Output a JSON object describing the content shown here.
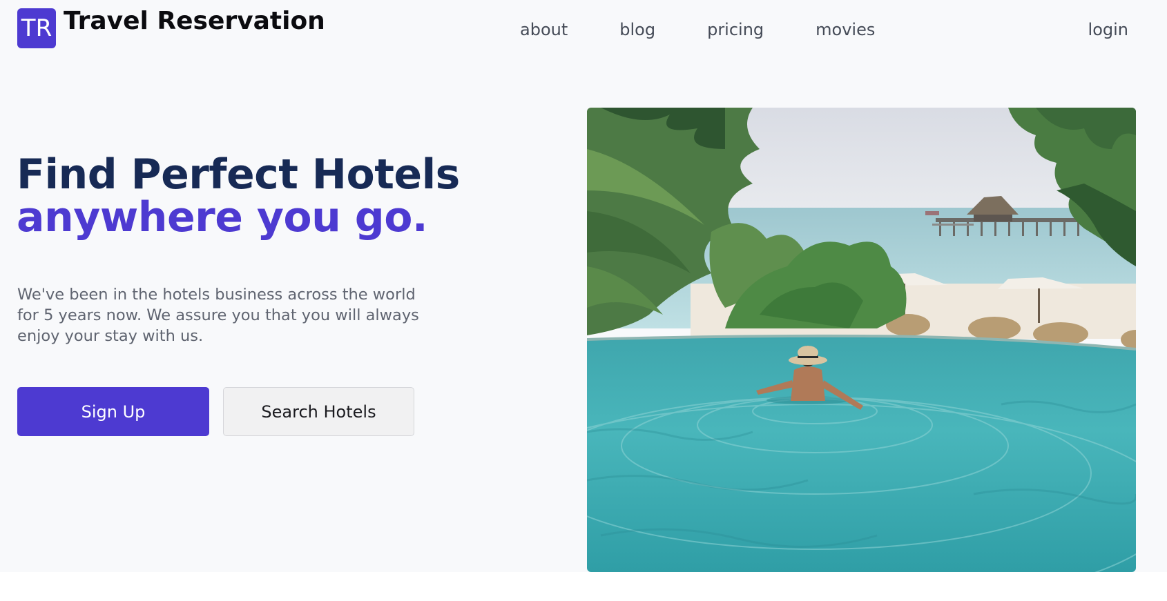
{
  "header": {
    "logo_initials": "TR",
    "brand_name": "Travel Reservation",
    "nav": [
      {
        "label": "about"
      },
      {
        "label": "blog"
      },
      {
        "label": "pricing"
      },
      {
        "label": "movies"
      }
    ],
    "login_label": "login"
  },
  "hero": {
    "headline_line1": "Find Perfect Hotels",
    "headline_line2": "anywhere you go.",
    "description": "We've been in the hotels business across the world for 5 years now. We assure you that you will always enjoy your stay with us.",
    "primary_button": "Sign Up",
    "secondary_button": "Search Hotels"
  },
  "colors": {
    "accent": "#4d3ad1",
    "headline_dark": "#172a55",
    "page_bg": "#f8f9fb",
    "body_text": "#5f6470"
  }
}
